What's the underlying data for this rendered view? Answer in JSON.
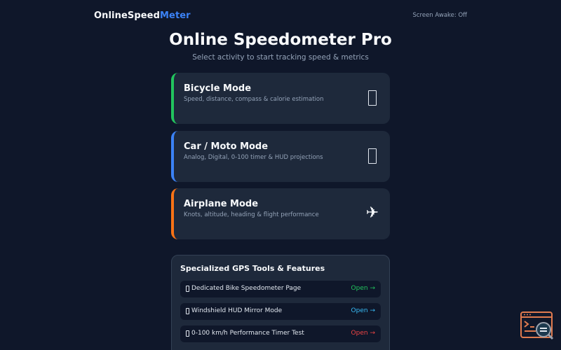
{
  "header": {
    "brand_part1": "OnlineSpeed",
    "brand_part2": "Meter",
    "screen_awake": "Screen Awake: Off"
  },
  "hero": {
    "title": "Online Speedometer Pro",
    "subtitle": "Select activity to start tracking speed & metrics"
  },
  "modes": [
    {
      "title": "Bicycle Mode",
      "description": "Speed, distance, compass & calorie estimation",
      "icon": "bicycle-icon",
      "accent": "#22c55e"
    },
    {
      "title": "Car / Moto Mode",
      "description": "Analog, Digital, 0-100 timer & HUD projections",
      "icon": "car-icon",
      "accent": "#3b82f6"
    },
    {
      "title": "Airplane Mode",
      "description": "Knots, altitude, heading & flight performance",
      "icon": "airplane-icon",
      "icon_glyph": "✈",
      "accent": "#f97316"
    }
  ],
  "tools": {
    "title": "Specialized GPS Tools & Features",
    "items": [
      {
        "label": "Dedicated Bike Speedometer Page",
        "action": "Open →",
        "color": "#22c55e"
      },
      {
        "label": "Windshield HUD Mirror Mode",
        "action": "Open →",
        "color": "#38bdf8"
      },
      {
        "label": "0-100 km/h Performance Timer Test",
        "action": "Open →",
        "color": "#ef4444"
      }
    ]
  },
  "colors": {
    "background": "#0f172a",
    "card": "#1e293b",
    "brand_accent": "#3b82f6",
    "text_muted": "#94a3b8"
  }
}
